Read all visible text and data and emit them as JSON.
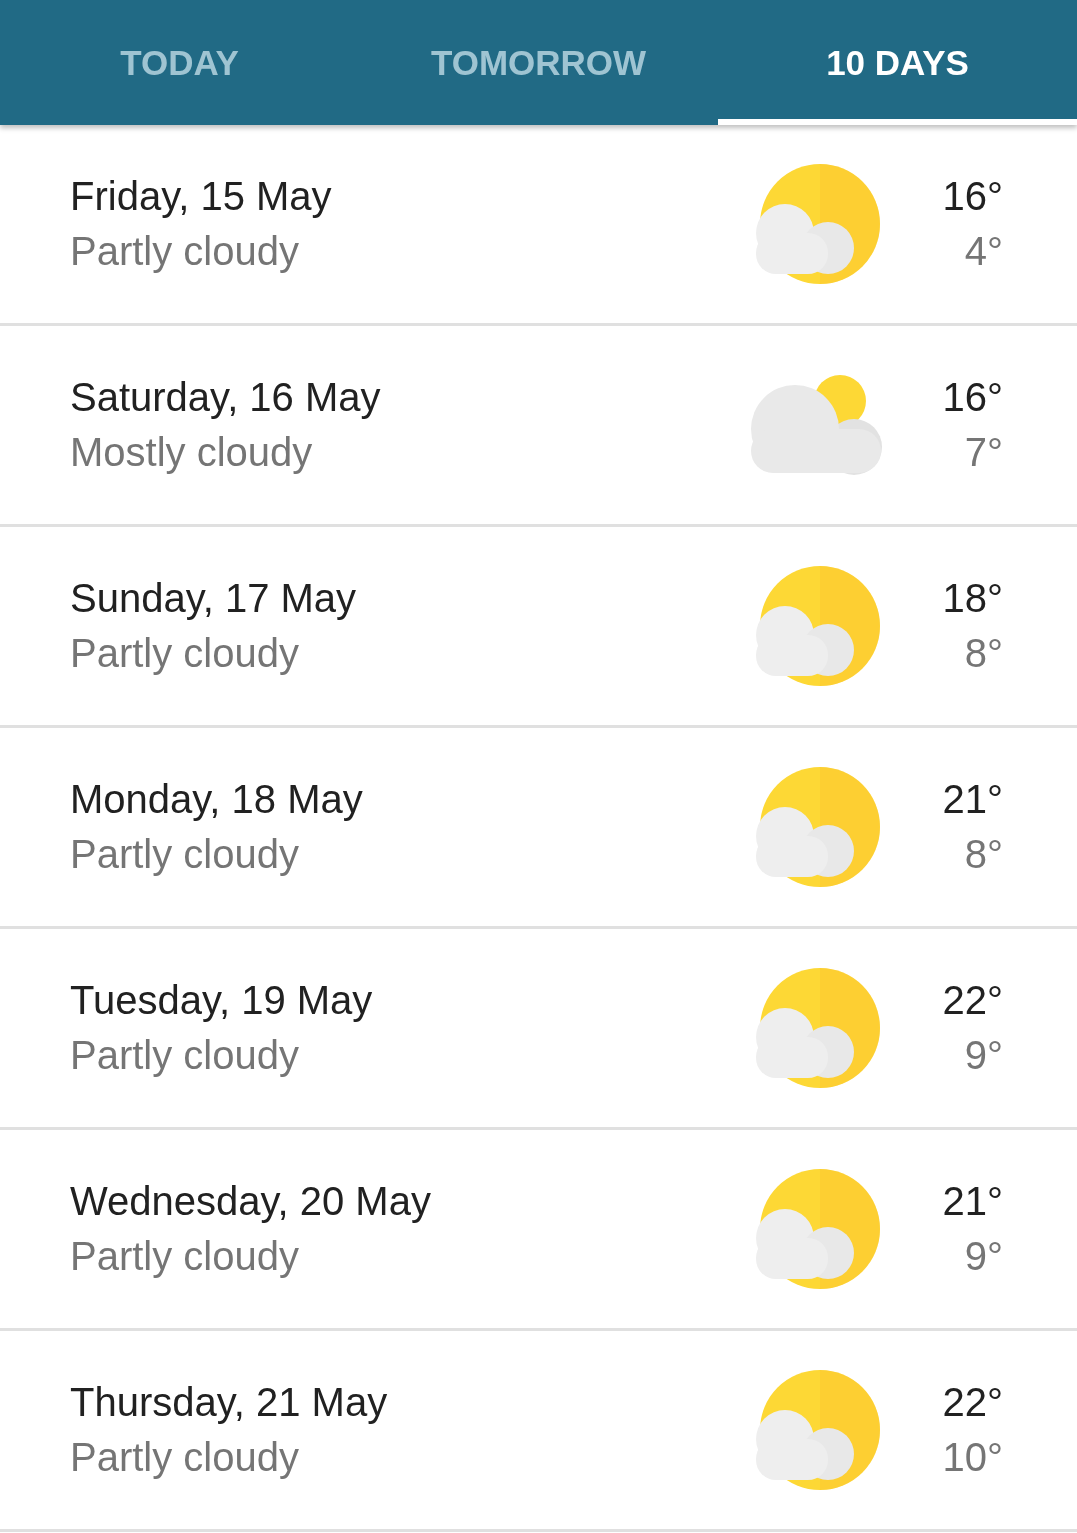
{
  "tabs": [
    {
      "label": "TODAY",
      "selected": false
    },
    {
      "label": "TOMORROW",
      "selected": false
    },
    {
      "label": "10 DAYS",
      "selected": true
    }
  ],
  "days": [
    {
      "date": "Friday, 15 May",
      "condition": "Partly cloudy",
      "kind": "partly",
      "high": "16°",
      "low": "4°"
    },
    {
      "date": "Saturday, 16 May",
      "condition": "Mostly cloudy",
      "kind": "mostly",
      "high": "16°",
      "low": "7°"
    },
    {
      "date": "Sunday, 17 May",
      "condition": "Partly cloudy",
      "kind": "partly",
      "high": "18°",
      "low": "8°"
    },
    {
      "date": "Monday, 18 May",
      "condition": "Partly cloudy",
      "kind": "partly",
      "high": "21°",
      "low": "8°"
    },
    {
      "date": "Tuesday, 19 May",
      "condition": "Partly cloudy",
      "kind": "partly",
      "high": "22°",
      "low": "9°"
    },
    {
      "date": "Wednesday, 20 May",
      "condition": "Partly cloudy",
      "kind": "partly",
      "high": "21°",
      "low": "9°"
    },
    {
      "date": "Thursday, 21 May",
      "condition": "Partly cloudy",
      "kind": "partly",
      "high": "22°",
      "low": "10°"
    }
  ]
}
